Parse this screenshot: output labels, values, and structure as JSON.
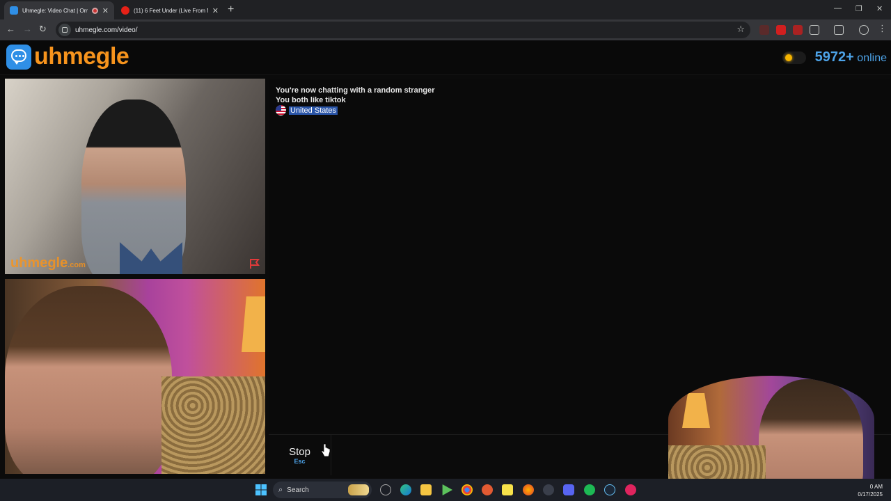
{
  "browser": {
    "tabs": [
      {
        "title": "Uhmegle: Video Chat | Om",
        "active": true
      },
      {
        "title": "(11) 6 Feet Under (Live From M",
        "active": false
      }
    ],
    "url": "uhmegle.com/video/"
  },
  "site": {
    "logo_text": "uhmegle",
    "online_count": "5972+",
    "online_label": "online",
    "watermark_main": "uhmegle",
    "watermark_suffix": ".com"
  },
  "chat": {
    "lines": [
      "You're now chatting with a random stranger",
      "You both like tiktok"
    ],
    "country": "United States"
  },
  "controls": {
    "stop_label": "Stop",
    "stop_key": "Esc"
  },
  "taskbar": {
    "search_placeholder": "Search",
    "time": "0 AM",
    "date": "0/17/2025"
  },
  "colors": {
    "brand_orange": "#f7941d",
    "accent_blue": "#4da3e8",
    "background": "#0b0b0b"
  },
  "icons": [
    "back-icon",
    "forward-icon",
    "reload-icon",
    "bookmark-star-icon",
    "extensions-icon",
    "profile-icon",
    "menu-icon",
    "windows-start-icon",
    "search-icon",
    "report-flag-icon"
  ]
}
